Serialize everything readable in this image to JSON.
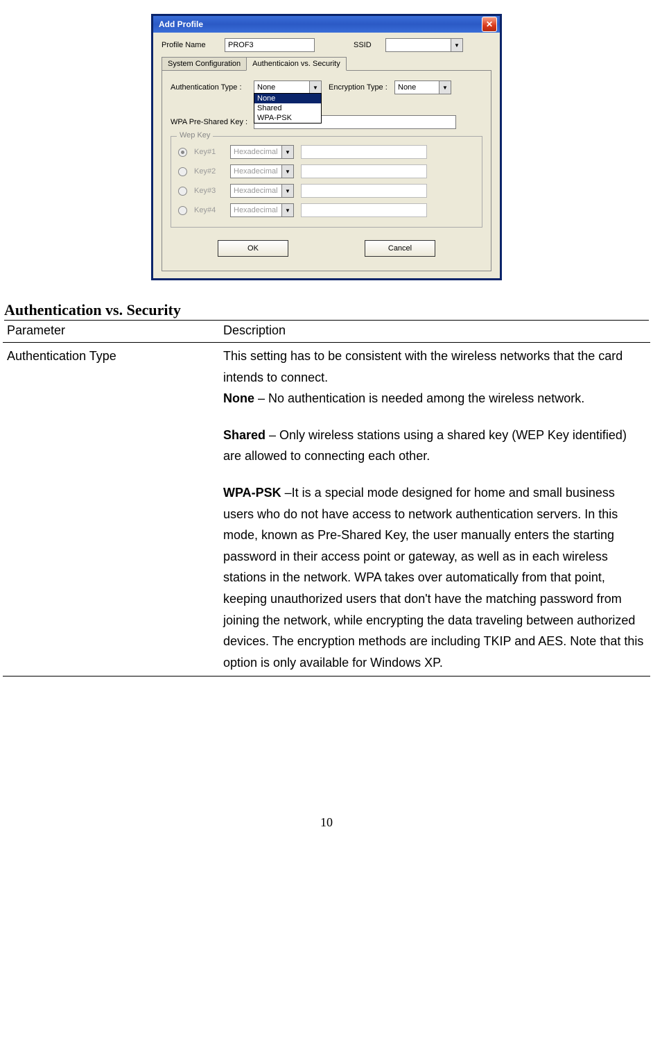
{
  "dialog": {
    "title": "Add Profile",
    "profile_name_label": "Profile Name",
    "profile_name_value": "PROF3",
    "ssid_label": "SSID",
    "ssid_value": "",
    "tabs": {
      "t1": "System Configuration",
      "t2": "Authenticaion vs. Security"
    },
    "auth_type_label": "Authentication Type :",
    "auth_type_value": "None",
    "auth_options": {
      "o0": "None",
      "o1": "Shared",
      "o2": "WPA-PSK"
    },
    "enc_type_label": "Encryption Type :",
    "enc_type_value": "None",
    "wpa_label": "WPA Pre-Shared Key :",
    "wep_group": "Wep Key",
    "keys": {
      "k1": "Key#1",
      "k2": "Key#2",
      "k3": "Key#3",
      "k4": "Key#4"
    },
    "hex_label": "Hexadecimal",
    "ok": "OK",
    "cancel": "Cancel"
  },
  "doc": {
    "heading": "Authentication vs. Security",
    "col_param": "Parameter",
    "col_desc": "Description",
    "row": {
      "param": "Authentication Type",
      "d1": "This setting has to be consistent with the wireless networks that the card intends to connect.",
      "d2a": "None",
      "d2b": " – No authentication is needed among the wireless network.",
      "d3a": "Shared",
      "d3b": " – Only wireless stations using a shared key (WEP Key identified) are allowed to connecting each other.",
      "d4a": "WPA-PSK",
      "d4b": " –It is a special mode designed for home and small business users who do not have access to network authentication servers. In this mode, known as Pre-Shared Key, the user manually enters the starting password in their access point or gateway, as well as in each wireless stations in the network. WPA takes over automatically from that point, keeping unauthorized users that don't have the matching password from joining the network, while encrypting the data traveling between authorized devices. The encryption methods are including TKIP and AES. Note that this option is only available for Windows XP."
    },
    "page_number": "10"
  }
}
